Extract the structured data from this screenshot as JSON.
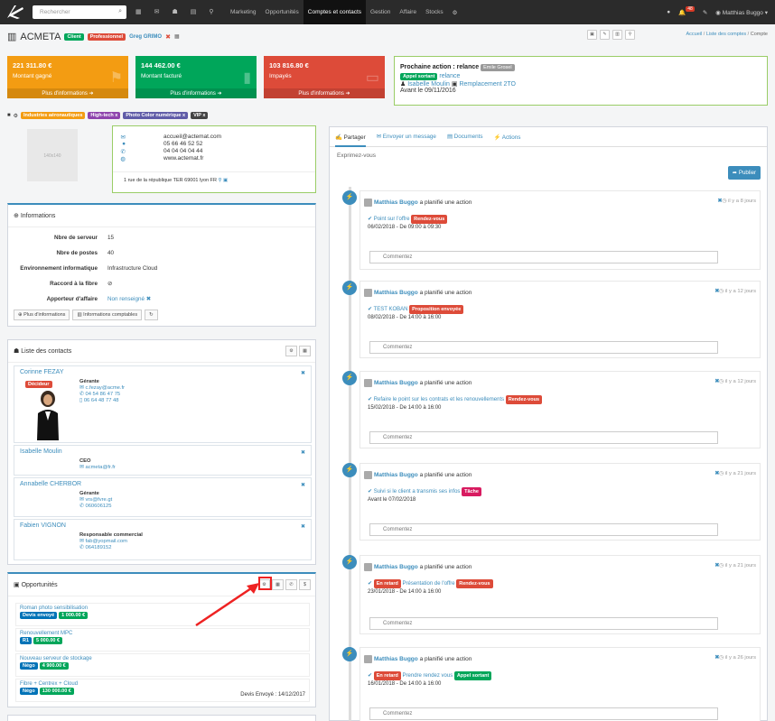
{
  "nav": {
    "search_placeholder": "Rechercher",
    "items": [
      "Marketing",
      "Opportunités",
      "Comptes et contacts",
      "Gestion",
      "Affaire",
      "Stocks"
    ],
    "active": "Comptes et contacts",
    "notif_count": "48",
    "user": "Matthias Buggo"
  },
  "header": {
    "company": "ACMETA",
    "label1": "Client",
    "label2": "Professionnel",
    "user_tag": "Greg GRIMO",
    "breadcrumb": [
      "Accueil",
      "Liste des comptes",
      "Compte"
    ]
  },
  "stats": [
    {
      "value": "221 311.80 €",
      "label": "Montant gagné",
      "footer": "Plus d'informations ➜",
      "color": "#f39c12"
    },
    {
      "value": "144 462.00 €",
      "label": "Montant facturé",
      "footer": "Plus d'informations ➜",
      "color": "#00a65a"
    },
    {
      "value": "103 816.80 €",
      "label": "Impayés",
      "footer": "Plus d'informations ➜",
      "color": "#dd4b39"
    }
  ],
  "next_action": {
    "title": "Prochaine action : relance",
    "badge": "Emile Grosel",
    "tag": "Appel sortant",
    "link": "relance",
    "person": "Isabelle Moulin",
    "detail": "Remplacement 2TO",
    "date": "Avant le 09/11/2016"
  },
  "tags": [
    "Industries aéronautiques",
    "High-tech x",
    "Photo Color numérique x",
    "VIP x"
  ],
  "contact_card": {
    "photo_text": "140x140",
    "email": "accueil@actemat.com",
    "phone1": "05 66 46 52 52",
    "phone2": "04 04 04 04 44",
    "website": "www.actemat.fr",
    "address": "1 rue de la république TER 69001 lyon FR"
  },
  "informations": {
    "title": "Informations",
    "rows": [
      {
        "k": "Nbre de serveur",
        "v": "15"
      },
      {
        "k": "Nbre de postes",
        "v": "40"
      },
      {
        "k": "Environnement informatique",
        "v": "Infrastructure Cloud"
      },
      {
        "k": "Raccord à la fibre",
        "v": "⊘"
      },
      {
        "k": "Apporteur d'affaire",
        "v": "Non renseigné ✖"
      }
    ],
    "buttons": [
      "Plus d'informations",
      "Informations comptables",
      "↻"
    ]
  },
  "contacts": {
    "title": "Liste des contacts",
    "items": [
      {
        "name": "Corinne FEZAY",
        "role": "Gérante",
        "badge": "Décideur",
        "email": "c.fezay@acme.fr",
        "phone": "04 54 86 47 75",
        "mobile": "06 64 48 77 48"
      },
      {
        "name": "Isabelle Moulin",
        "role": "CEO",
        "email": "acmeta@fr.fr"
      },
      {
        "name": "Annabelle CHERBOR",
        "role": "Gérante",
        "email": "vrs@fvre.gt",
        "phone": "060606125"
      },
      {
        "name": "Fabien VIGNON",
        "role": "Responsable commercial",
        "email": "fab@yopmail.com",
        "phone": "064189152"
      }
    ]
  },
  "opportunities": {
    "title": "Opportunités",
    "items": [
      {
        "name": "Roman photo sensibilisation",
        "l1": "Devis envoyé",
        "l2": "1 000.00 €"
      },
      {
        "name": "Renouvellement MPC",
        "l1": "R1",
        "l2": "5 000.00 €"
      },
      {
        "name": "Nouveau serveur de stockage",
        "l1": "Négo",
        "l2": "4 900.00 €"
      },
      {
        "name": "Fibre + Centrex + Cloud",
        "l1": "Négo",
        "l2": "130 000.00 €",
        "status": "Devis Envoyé : 14/12/2017"
      }
    ]
  },
  "feed": {
    "tabs": [
      "Partager",
      "Envoyer un message",
      "Documents",
      "Actions"
    ],
    "placeholder": "Exprimez-vous",
    "publish": "Publier",
    "comment": "Commentez",
    "items": [
      {
        "user": "Matthias Buggo",
        "action": "a planifié une action",
        "ago": "il y a 8 jours",
        "title": "Point sur l'offre",
        "label": "Rendez-vous",
        "date": "06/02/2018 - De 09:00 à 09:30"
      },
      {
        "user": "Matthias Buggo",
        "action": "a planifié une action",
        "ago": "il y a 12 jours",
        "title": "TEST KOBAN",
        "label": "Proposition envoyée",
        "date": "08/02/2018 - De 14:00 à 16:00"
      },
      {
        "user": "Matthias Buggo",
        "action": "a planifié une action",
        "ago": "il y a 12 jours",
        "title": "Refaire le point sur les contrats et les renouvellements",
        "label": "Rendez-vous",
        "date": "15/02/2018 - De 14:00 à 16:00"
      },
      {
        "user": "Matthias Buggo",
        "action": "a planifié une action",
        "ago": "il y a 21 jours",
        "title": "Suivi si le client a transmis ses infos",
        "label": "Tâche",
        "date": "Avant le 07/02/2018"
      },
      {
        "user": "Matthias Buggo",
        "action": "a planifié une action",
        "ago": "il y a 21 jours",
        "pre": "En retard",
        "title": "Présentation de l'offre",
        "label": "Rendez-vous",
        "date": "23/01/2018 - De 14:00 à 16:00"
      },
      {
        "user": "Matthias Buggo",
        "action": "a planifié une action",
        "ago": "il y a 26 jours",
        "pre": "En retard",
        "title": "Prendre rendez vous",
        "label": "Appel sortant",
        "date": "16/01/2018 - De 14:00 à 16:00"
      }
    ]
  }
}
